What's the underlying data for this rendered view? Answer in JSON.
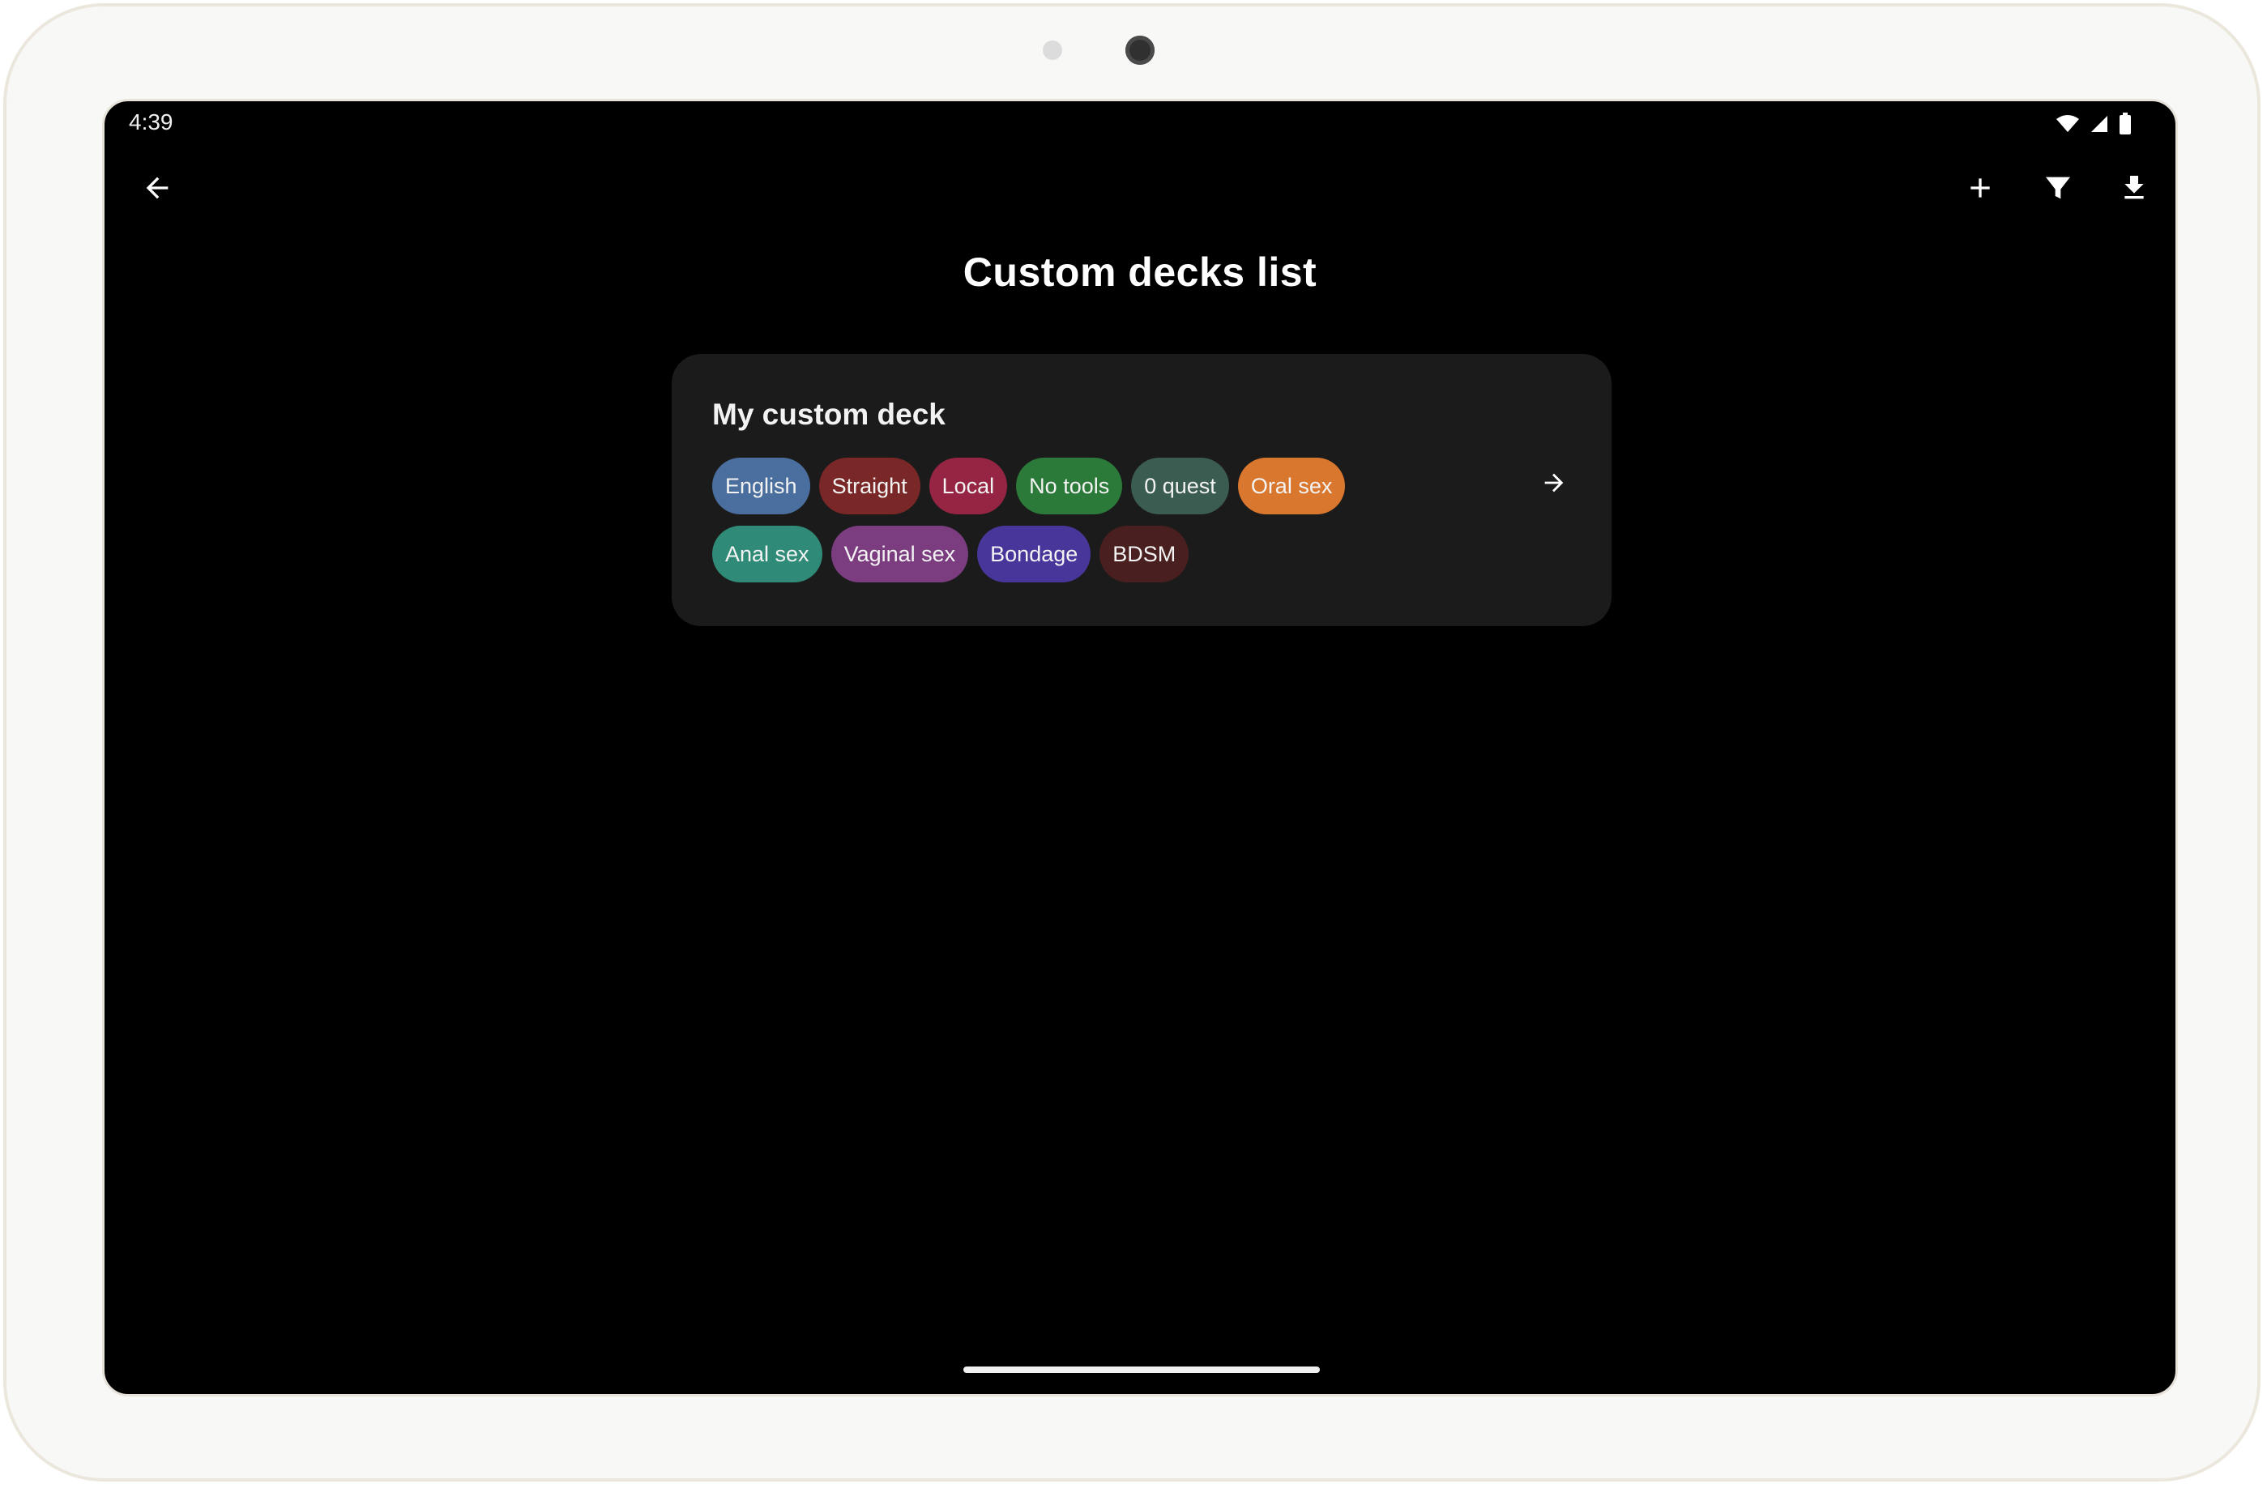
{
  "status_bar": {
    "time": "4:39",
    "icons": [
      "wifi-icon",
      "cell-signal-icon",
      "battery-icon"
    ]
  },
  "app_bar": {
    "back_icon": "arrow-left-icon",
    "actions": [
      "plus-icon",
      "filter-icon",
      "download-icon"
    ]
  },
  "page": {
    "title": "Custom decks list"
  },
  "decks": [
    {
      "name": "My custom deck",
      "open_icon": "arrow-right-icon",
      "tags": [
        {
          "label": "English",
          "color": "#4a6e9d"
        },
        {
          "label": "Straight",
          "color": "#7a2727"
        },
        {
          "label": "Local",
          "color": "#952542"
        },
        {
          "label": "No tools",
          "color": "#2b7a39"
        },
        {
          "label": "0 quest",
          "color": "#3b5c50"
        },
        {
          "label": "Oral sex",
          "color": "#d9772f"
        },
        {
          "label": "Anal sex",
          "color": "#2f8b77"
        },
        {
          "label": "Vaginal sex",
          "color": "#7b3d80"
        },
        {
          "label": "Bondage",
          "color": "#48369a"
        },
        {
          "label": "BDSM",
          "color": "#4a1f1f"
        }
      ]
    }
  ]
}
